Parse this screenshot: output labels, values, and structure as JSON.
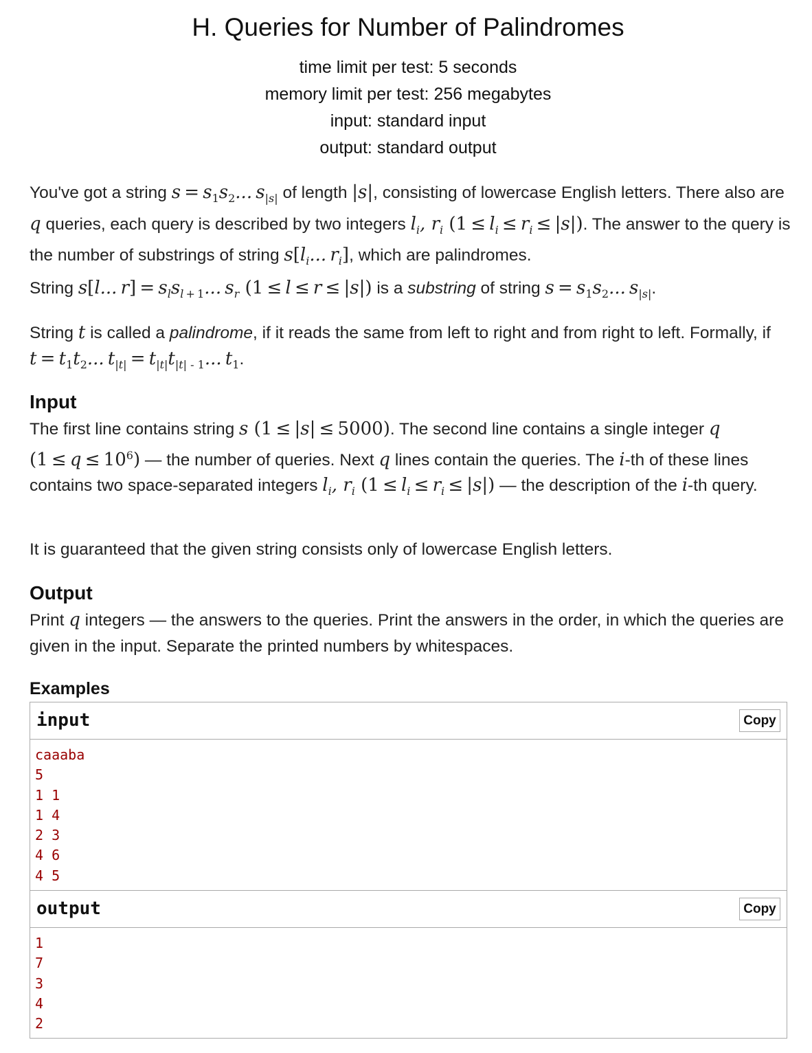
{
  "problem": {
    "title": "H. Queries for Number of Palindromes",
    "time_limit": "time limit per test: 5 seconds",
    "memory_limit": "memory limit per test: 256 megabytes",
    "input_file": "input: standard input",
    "output_file": "output: standard output"
  },
  "statement": {
    "p1_a": "You've got a string ",
    "p1_b": " of length ",
    "p1_c": ", consisting of lowercase English letters. There also are ",
    "p1_d": " queries, each query is described by two integers ",
    "p1_e": ". The answer to the query is the number of substrings of string ",
    "p1_f": ", which are palindromes.",
    "p2_a": "String ",
    "p2_b": " is a ",
    "p2_c": "substring",
    "p2_d": " of string ",
    "p2_e": ".",
    "p3_a": "String ",
    "p3_b": " is called a ",
    "p3_c": "palindrome",
    "p3_d": ", if it reads the same from left to right and from right to left. Formally, if ",
    "p3_e": "."
  },
  "input_section": {
    "title": "Input",
    "p1_a": "The first line contains string ",
    "p1_b": ". The second line contains a single integer ",
    "p1_c": " — the number of queries. Next ",
    "p1_d": " lines contain the queries. The ",
    "p1_e": "-th of these lines contains two space-separated integers ",
    "p1_f": " — the description of the ",
    "p1_g": "-th query.",
    "p2": "It is guaranteed that the given string consists only of lowercase English letters."
  },
  "output_section": {
    "title": "Output",
    "p1_a": "Print ",
    "p1_b": " integers — the answers to the queries. Print the answers in the order, in which the queries are given in the input. Separate the printed numbers by whitespaces."
  },
  "examples": {
    "title": "Examples",
    "input_label": "input",
    "output_label": "output",
    "copy_label": "Copy",
    "input_lines": [
      "caaaba",
      "5",
      "1 1",
      "1 4",
      "2 3",
      "4 6",
      "4 5"
    ],
    "output_lines": [
      "1",
      "7",
      "3",
      "4",
      "2"
    ]
  }
}
